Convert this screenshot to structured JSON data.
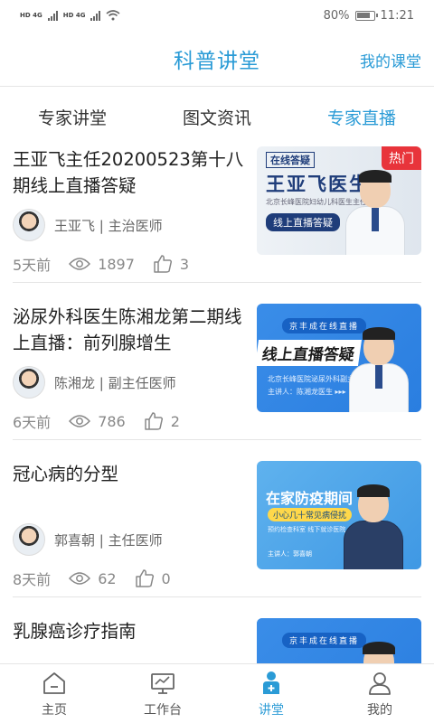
{
  "status": {
    "net1": "HD 4G",
    "net2": "HD 4G",
    "battery": "80%",
    "time": "11:21"
  },
  "header": {
    "title": "科普讲堂",
    "right_link": "我的课堂"
  },
  "tabs": [
    {
      "label": "专家讲堂",
      "active": false
    },
    {
      "label": "图文资讯",
      "active": false
    },
    {
      "label": "专家直播",
      "active": true
    }
  ],
  "items": [
    {
      "title": "王亚飞主任20200523第十八期线上直播答疑",
      "author": "王亚飞 | 主治医师",
      "time": "5天前",
      "views": "1897",
      "likes": "3",
      "thumb": {
        "badge": "热门",
        "line1": "在线答疑",
        "line2": "王亚飞医生",
        "line3": "北京长峰医院妇幼儿科医生主任",
        "line4": "线上直播答疑"
      }
    },
    {
      "title": "泌尿外科医生陈湘龙第二期线上直播：前列腺增生",
      "author": "陈湘龙 | 副主任医师",
      "time": "6天前",
      "views": "786",
      "likes": "2",
      "thumb": {
        "bar": "京丰成在线直播",
        "big": "线上直播答疑",
        "sub": "北京长峰医院泌尿外科副主任医师",
        "sub2": "主讲人：陈湘龙医生 ▸▸▸"
      }
    },
    {
      "title": "冠心病的分型",
      "author": "郭喜朝 | 主任医师",
      "time": "8天前",
      "views": "62",
      "likes": "0",
      "thumb": {
        "h1": "在家防疫期间",
        "h2": "小心几十常见病侵扰",
        "h3": "预约检查科室\n线下就诊医院",
        "h4": "主讲人：郭喜朝"
      }
    },
    {
      "title": "乳腺癌诊疗指南",
      "thumb": {
        "bar": "京丰成在线直播"
      }
    }
  ],
  "nav": [
    {
      "label": "主页",
      "icon": "home-icon",
      "active": false
    },
    {
      "label": "工作台",
      "icon": "workbench-icon",
      "active": false
    },
    {
      "label": "讲堂",
      "icon": "lecture-icon",
      "active": true
    },
    {
      "label": "我的",
      "icon": "profile-icon",
      "active": false
    }
  ],
  "colors": {
    "accent": "#2a9bd6",
    "hot_badge": "#e8343b"
  }
}
